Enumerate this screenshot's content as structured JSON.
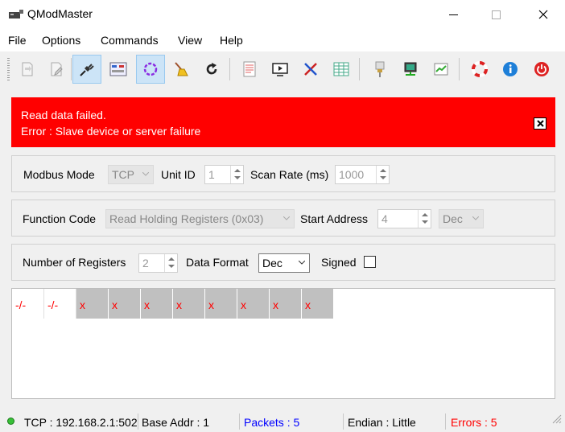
{
  "window": {
    "title": "QModMaster"
  },
  "menu": [
    {
      "label": "File"
    },
    {
      "label": "Options"
    },
    {
      "label": "Commands"
    },
    {
      "label": "View"
    },
    {
      "label": "Help"
    }
  ],
  "toolbar": [
    {
      "icon": "load-session-icon"
    },
    {
      "icon": "save-session-icon"
    },
    {
      "icon": "connect-icon",
      "active": true
    },
    {
      "icon": "read-write-icon"
    },
    {
      "icon": "scan-icon",
      "active": true
    },
    {
      "icon": "clear-icon"
    },
    {
      "icon": "reset-counters-icon"
    },
    {
      "icon": "bus-monitor-icon"
    },
    {
      "icon": "tools-icon"
    },
    {
      "icon": "serial-settings-icon"
    },
    {
      "icon": "modbus-rtu-icon"
    },
    {
      "icon": "modbus-tcp-icon"
    },
    {
      "icon": "settings-icon"
    },
    {
      "icon": "help-icon"
    },
    {
      "icon": "about-icon"
    },
    {
      "icon": "exit-icon"
    }
  ],
  "error": {
    "line1": "Read data failed.",
    "line2": "Error : Slave device or server failure"
  },
  "modbus": {
    "mode_label": "Modbus Mode",
    "mode_value": "TCP",
    "unit_id_label": "Unit ID",
    "unit_id_value": "1",
    "scan_rate_label": "Scan Rate (ms)",
    "scan_rate_value": "1000"
  },
  "function": {
    "code_label": "Function Code",
    "code_value": "Read Holding Registers (0x03)",
    "start_address_label": "Start Address",
    "start_address_value": "4",
    "address_format_value": "Dec"
  },
  "registers": {
    "count_label": "Number of Registers",
    "count_value": "2",
    "data_format_label": "Data Format",
    "data_format_value": "Dec",
    "signed_label": "Signed"
  },
  "grid_cells": [
    "-/-",
    "-/-",
    "x",
    "x",
    "x",
    "x",
    "x",
    "x",
    "x",
    "x"
  ],
  "status": {
    "connection": "TCP : 192.168.2.1:502",
    "base_addr": "Base Addr : 1",
    "packets": "Packets : 5",
    "endian": "Endian : Little",
    "errors": "Errors : 5"
  },
  "colors": {
    "error_banner": "#ff0000",
    "packets_text": "#0000ff",
    "errors_text": "#ff0000",
    "cell_error_bg": "#c0c0c0"
  }
}
